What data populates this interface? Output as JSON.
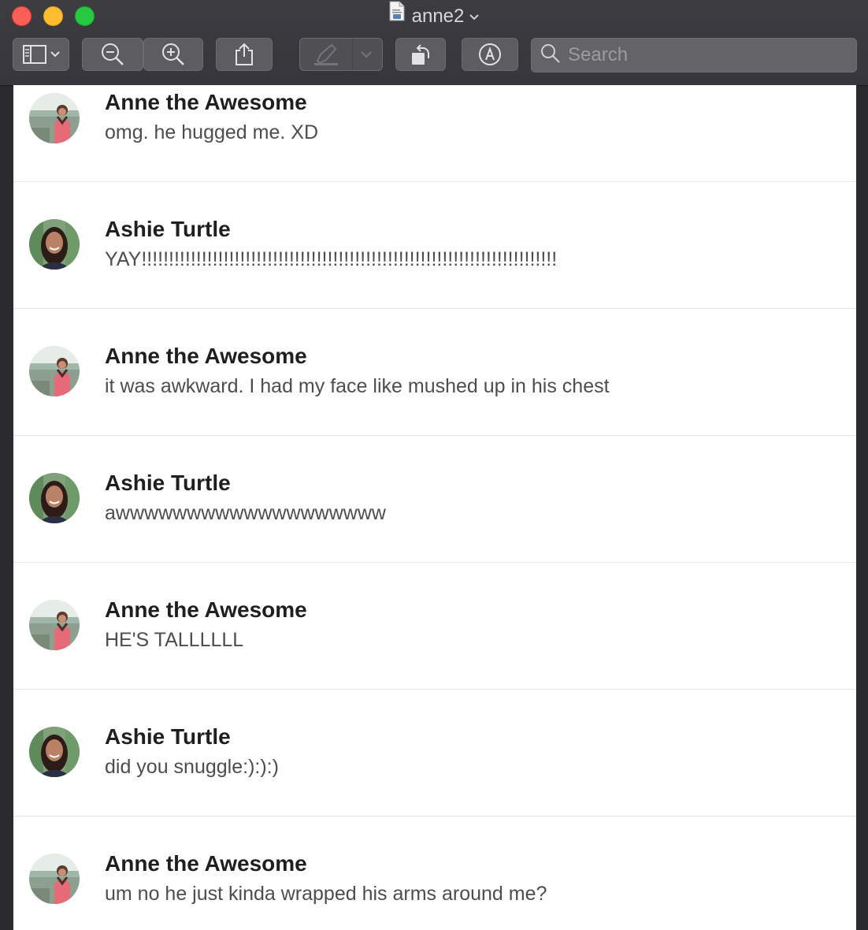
{
  "window": {
    "title": "anne2"
  },
  "toolbar": {
    "buttons": [
      {
        "icon": "sidebar-icon"
      },
      {
        "icon": "zoom-out-icon"
      },
      {
        "icon": "zoom-in-icon"
      },
      {
        "icon": "share-icon"
      },
      {
        "icon": "highlight-pen-icon"
      },
      {
        "icon": "rotate-icon"
      },
      {
        "icon": "markup-icon"
      }
    ],
    "search": {
      "placeholder": "Search",
      "value": ""
    }
  },
  "messages": [
    {
      "sender": "Anne the Awesome",
      "text": "omg. he hugged me. XD",
      "avatar": "anne-avatar"
    },
    {
      "sender": "Ashie Turtle",
      "text": "YAY!!!!!!!!!!!!!!!!!!!!!!!!!!!!!!!!!!!!!!!!!!!!!!!!!!!!!!!!!!!!!!!!!!!!!!!!!!!!",
      "avatar": "ashie-avatar"
    },
    {
      "sender": "Anne the Awesome",
      "text": "it was awkward. I had my face like mushed up in his chest",
      "avatar": "anne-avatar"
    },
    {
      "sender": "Ashie Turtle",
      "text": "awwwwwwwwwwwwwwwwwww",
      "avatar": "ashie-avatar"
    },
    {
      "sender": "Anne the Awesome",
      "text": "HE'S TALLLLLL",
      "avatar": "anne-avatar"
    },
    {
      "sender": "Ashie Turtle",
      "text": "did you snuggle:):):)",
      "avatar": "ashie-avatar"
    },
    {
      "sender": "Anne the Awesome",
      "text": "um no he just kinda wrapped his arms around me?",
      "avatar": "anne-avatar"
    }
  ],
  "colors": {
    "close": "#fd5e57",
    "minimize": "#febc2e",
    "maximize": "#28c840",
    "toolbar_bg": "#3a393e",
    "page_bg": "#ffffff"
  }
}
